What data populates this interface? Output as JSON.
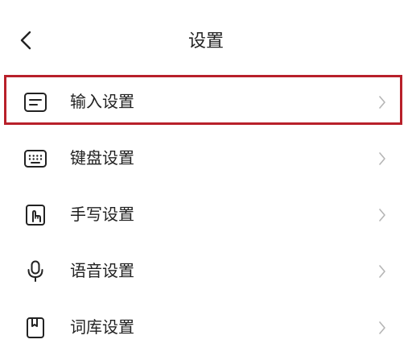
{
  "header": {
    "title": "设置",
    "back_icon": "chevron-left-icon"
  },
  "settings_list": {
    "items": [
      {
        "label": "输入设置",
        "icon": "input-icon",
        "highlighted": true
      },
      {
        "label": "键盘设置",
        "icon": "keyboard-icon",
        "highlighted": false
      },
      {
        "label": "手写设置",
        "icon": "handwriting-icon",
        "highlighted": false
      },
      {
        "label": "语音设置",
        "icon": "microphone-icon",
        "highlighted": false
      },
      {
        "label": "词库设置",
        "icon": "dictionary-icon",
        "highlighted": false
      }
    ],
    "chevron_icon": "chevron-right-icon"
  },
  "colors": {
    "highlight_border": "#b8202a",
    "text": "#222222",
    "chevron": "#b5b5b5"
  }
}
